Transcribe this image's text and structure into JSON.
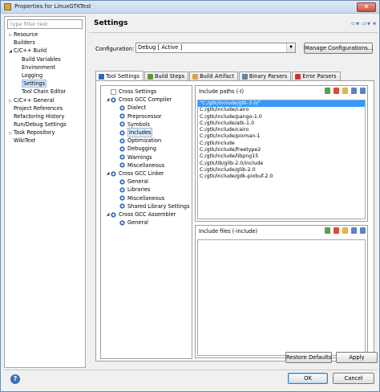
{
  "window": {
    "title": "Properties for LinuxGTKTest"
  },
  "left": {
    "filter_placeholder": "type filter text",
    "items": [
      {
        "label": "Resource",
        "indent": 0,
        "twisty": "▷"
      },
      {
        "label": "Builders",
        "indent": 0,
        "twisty": ""
      },
      {
        "label": "C/C++ Build",
        "indent": 0,
        "twisty": "◢"
      },
      {
        "label": "Build Variables",
        "indent": 1,
        "twisty": ""
      },
      {
        "label": "Environment",
        "indent": 1,
        "twisty": ""
      },
      {
        "label": "Logging",
        "indent": 1,
        "twisty": ""
      },
      {
        "label": "Settings",
        "indent": 1,
        "twisty": "",
        "selected": true
      },
      {
        "label": "Tool Chain Editor",
        "indent": 1,
        "twisty": ""
      },
      {
        "label": "C/C++ General",
        "indent": 0,
        "twisty": "▷"
      },
      {
        "label": "Project References",
        "indent": 0,
        "twisty": ""
      },
      {
        "label": "Refactoring History",
        "indent": 0,
        "twisty": ""
      },
      {
        "label": "Run/Debug Settings",
        "indent": 0,
        "twisty": ""
      },
      {
        "label": "Task Repository",
        "indent": 0,
        "twisty": "▷"
      },
      {
        "label": "WikiText",
        "indent": 0,
        "twisty": ""
      }
    ]
  },
  "header": {
    "title": "Settings",
    "back_icon": "back-arrow-icon",
    "forward_icon": "forward-arrow-icon"
  },
  "configuration": {
    "label": "Configuration:",
    "value": "Debug  [ Active ]",
    "manage_label": "Manage Configurations..."
  },
  "tabs": [
    {
      "label": "Tool Settings",
      "active": true,
      "color": "#2f6db5"
    },
    {
      "label": "Build Steps",
      "color": "#6a8f3c"
    },
    {
      "label": "Build Artifact",
      "color": "#d9a441"
    },
    {
      "label": "Binary Parsers",
      "color": "#6b7fa0"
    },
    {
      "label": "Error Parsers",
      "color": "#cc3333"
    }
  ],
  "settings_tree": [
    {
      "label": "Cross Settings",
      "indent": 0,
      "twisty": "",
      "icon": "doc"
    },
    {
      "label": "Cross GCC Compiler",
      "indent": 0,
      "twisty": "◢",
      "icon": "gear"
    },
    {
      "label": "Dialect",
      "indent": 1,
      "twisty": "",
      "icon": "gear"
    },
    {
      "label": "Preprocessor",
      "indent": 1,
      "twisty": "",
      "icon": "gear"
    },
    {
      "label": "Symbols",
      "indent": 1,
      "twisty": "",
      "icon": "gear"
    },
    {
      "label": "Includes",
      "indent": 1,
      "twisty": "",
      "icon": "gear",
      "selected": true
    },
    {
      "label": "Optimization",
      "indent": 1,
      "twisty": "",
      "icon": "gear"
    },
    {
      "label": "Debugging",
      "indent": 1,
      "twisty": "",
      "icon": "gear"
    },
    {
      "label": "Warnings",
      "indent": 1,
      "twisty": "",
      "icon": "gear"
    },
    {
      "label": "Miscellaneous",
      "indent": 1,
      "twisty": "",
      "icon": "gear"
    },
    {
      "label": "Cross GCC Linker",
      "indent": 0,
      "twisty": "◢",
      "icon": "gear"
    },
    {
      "label": "General",
      "indent": 1,
      "twisty": "",
      "icon": "gear"
    },
    {
      "label": "Libraries",
      "indent": 1,
      "twisty": "",
      "icon": "gear"
    },
    {
      "label": "Miscellaneous",
      "indent": 1,
      "twisty": "",
      "icon": "gear"
    },
    {
      "label": "Shared Library Settings",
      "indent": 1,
      "twisty": "",
      "icon": "gear"
    },
    {
      "label": "Cross GCC Assembler",
      "indent": 0,
      "twisty": "◢",
      "icon": "gear"
    },
    {
      "label": "General",
      "indent": 1,
      "twisty": "",
      "icon": "gear"
    }
  ],
  "include_paths": {
    "label": "Include paths (-I)",
    "items": [
      "\"C:/gtk/include/gtk-3.0/\"",
      "C:/gtk/include/cairo",
      "C:/gtk/include/pango-1.0",
      "C:/gtk/include/atk-1.0",
      "C:/gtk/include/cairo",
      "C:/gtk/include/pixman-1",
      "C:/gtk/include",
      "C:/gtk/include/freetype2",
      "C:/gtk/include/libpng15",
      "C:/gtk/lib/glib-2.0/include",
      "C:/gtk/include/glib-2.0",
      "C:/gtk/include/gdk-pixbuf-2.0"
    ]
  },
  "include_files": {
    "label": "Include files (-include)",
    "items": []
  },
  "buttons": {
    "restore_defaults": "Restore Defaults",
    "apply": "Apply",
    "ok": "OK",
    "cancel": "Cancel"
  }
}
